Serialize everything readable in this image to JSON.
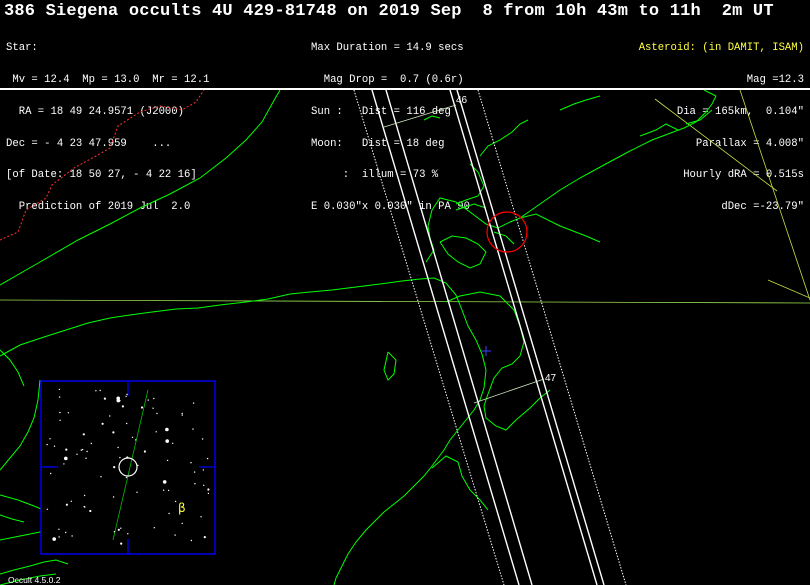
{
  "title": "386 Siegena occults 4U 429-81748 on 2019 Sep  8 from 10h 43m to 11h  2m UT",
  "star": [
    "Star:",
    " Mv = 12.4  Mp = 13.0  Mr = 12.1",
    "  RA = 18 49 24.9571 (J2000)",
    "Dec = - 4 23 47.959    ...",
    "[of Date: 18 50 27, - 4 22 16]",
    "  Prediction of 2019 Jul  2.0"
  ],
  "event": [
    "Max Duration = 14.9 secs",
    "  Mag Drop =  0.7 (0.6r)",
    "Sun :   Dist = 116 deg",
    "Moon:   Dist = 18 deg",
    "     :  illum = 73 %",
    "E 0.030\"x 0.030\" in PA 90"
  ],
  "asteroid_header": "Asteroid: (in DAMIT, ISAM)",
  "asteroid": [
    "Mag =12.3",
    "Dia = 165km,  0.104\"",
    "Parallax = 4.008\"",
    "Hourly dRA = 0.515s",
    "dDec =-23.79\""
  ],
  "path_labels": {
    "top": "46",
    "bottom": "47"
  },
  "star_symbol": "β",
  "version": "Occult 4.5.0.2",
  "colors": {
    "background": "#000000",
    "coastline": "#00ff00",
    "border": "#ff3030",
    "path": "#ffffff",
    "grid": "#9adf4f",
    "finder_frame": "#0000ff",
    "site_marker": "#ff0000",
    "center_cross": "#4040ff",
    "highlight": "#ffff40"
  }
}
